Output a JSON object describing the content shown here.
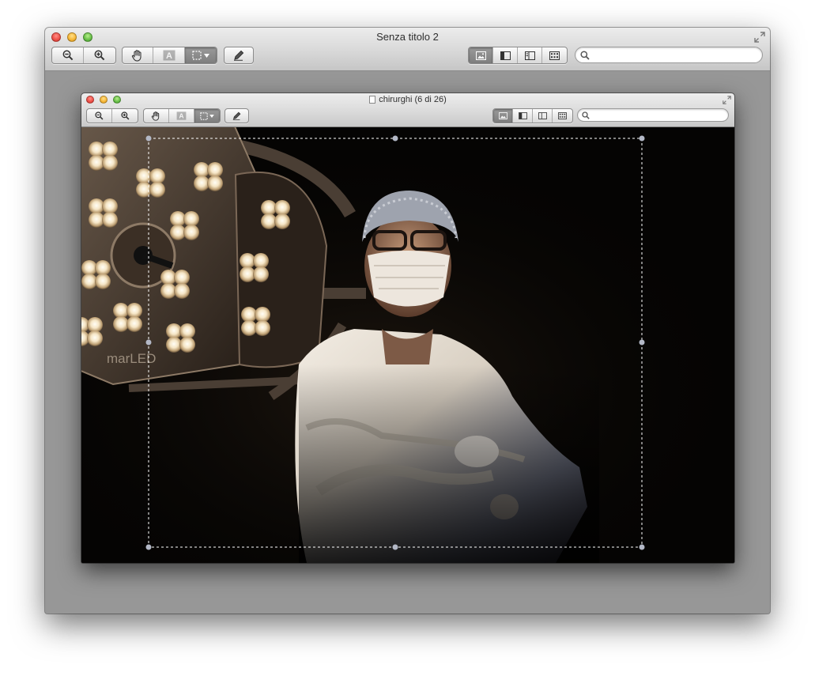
{
  "outer_window": {
    "title": "Senza titolo 2",
    "toolbar": {
      "zoom_out": "zoom-out-icon",
      "zoom_in": "zoom-in-icon",
      "move_tool": "hand-icon",
      "text_tool": "text-select-icon",
      "selection_tool": "rect-selection-icon",
      "edit_toolbar": "pencil-icon",
      "view_modes": [
        "content-only-icon",
        "sidebar-left-icon",
        "sidebar-right-icon",
        "thumbnails-grid-icon"
      ],
      "search_placeholder": ""
    }
  },
  "inner_window": {
    "title": "chirurghi (6 di 26)",
    "toolbar": {
      "search_placeholder": ""
    }
  },
  "photo": {
    "subject": "surgeon in mask and cap with crossed arms beside operating lamp",
    "lamp_brand_text": "marLED",
    "selection_handles": 8
  },
  "colors": {
    "window_bg": "#979797",
    "selection_dash": "#ffffff",
    "handle_fill": "#b3b8c6"
  }
}
